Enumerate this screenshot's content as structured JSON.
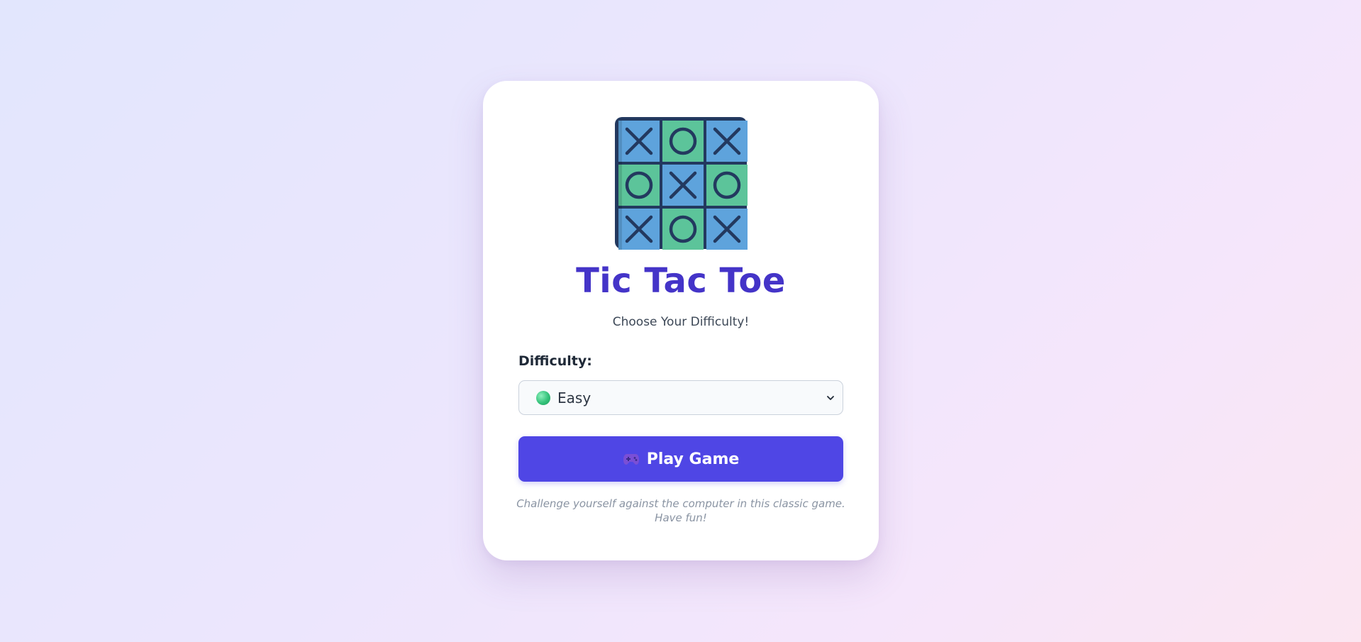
{
  "game": {
    "title": "Tic Tac Toe",
    "subtitle": "Choose Your Difficulty!",
    "difficulty_label": "Difficulty:",
    "difficulty_selected": "Easy",
    "difficulty_indicator_color": "#34c27a",
    "play_label": "Play Game",
    "play_icon": "gamepad-icon",
    "footnote_line1": "Challenge yourself against the computer in this classic game.",
    "footnote_line2": "Have fun!"
  },
  "board": {
    "cells": [
      "X",
      "O",
      "X",
      "O",
      "X",
      "O",
      "X",
      "O",
      "X"
    ],
    "colors": {
      "x_cell": "#5ea3dc",
      "o_cell": "#5cc49a",
      "ink": "#23395f"
    }
  },
  "colors": {
    "accent": "#4f46e5",
    "title": "#4434c8"
  }
}
